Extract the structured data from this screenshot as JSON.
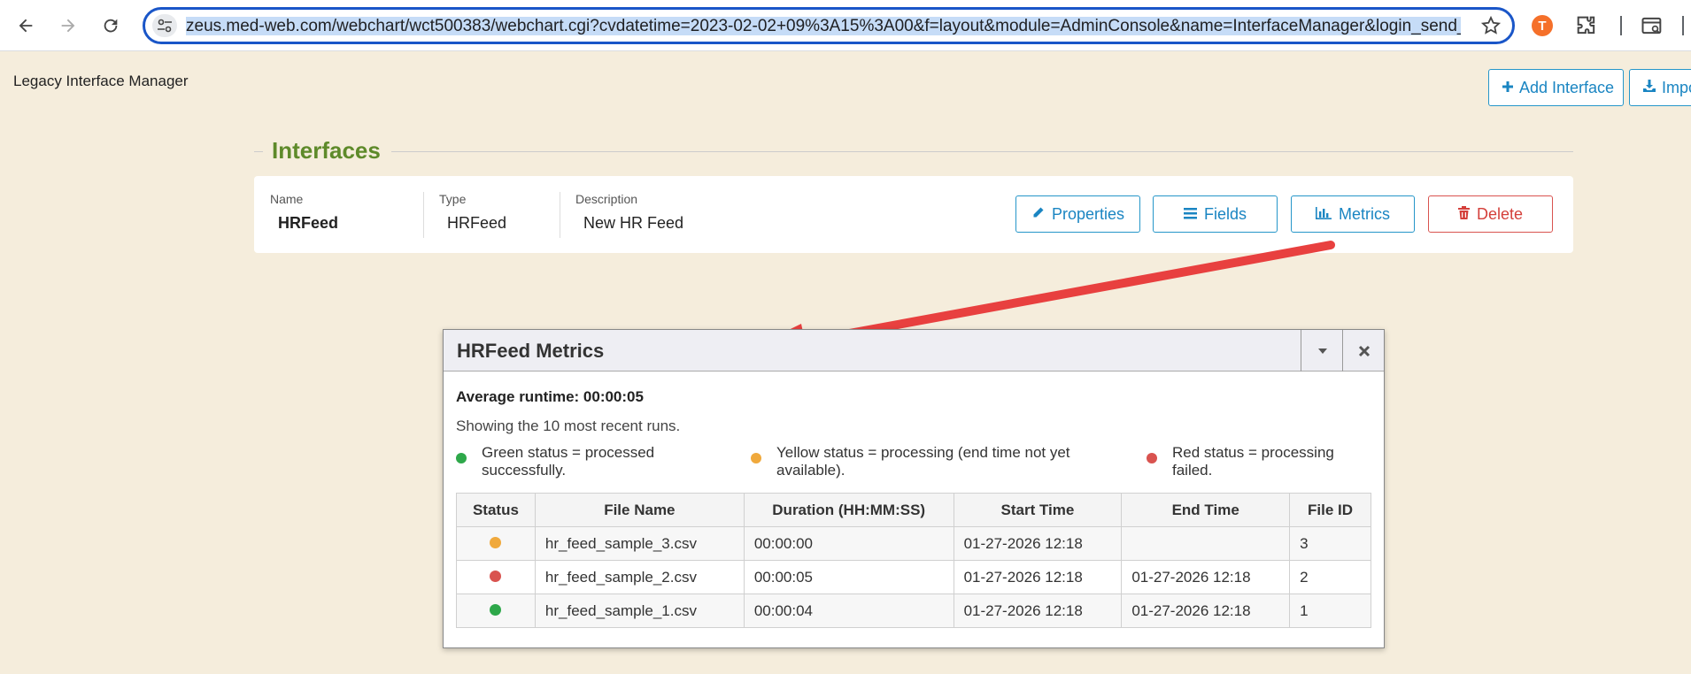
{
  "browser": {
    "url_highlighted": "zeus.med-web.com/webchart/wct500383/webchart.cgi?cvdatetime=2023-02-02+09%3A15%3A00&f=layout&module=AdminConsole&name=InterfaceManager&login_send_",
    "profile_initial": "T"
  },
  "page": {
    "app_title": "Legacy Interface Manager",
    "add_interface_label": "Add Interface",
    "import_label": "Impo"
  },
  "section": {
    "title": "Interfaces"
  },
  "interface": {
    "name_label": "Name",
    "name_value": "HRFeed",
    "type_label": "Type",
    "type_value": "HRFeed",
    "description_label": "Description",
    "description_value": "New HR Feed",
    "properties_label": "Properties",
    "fields_label": "Fields",
    "metrics_label": "Metrics",
    "delete_label": "Delete"
  },
  "dialog": {
    "title": "HRFeed Metrics",
    "average_runtime": "Average runtime: 00:00:05",
    "showing_text": "Showing the 10 most recent runs.",
    "legend": [
      {
        "color": "#2ea84a",
        "line1": "Green status = processed",
        "line2": "successfully."
      },
      {
        "color": "#f0a93c",
        "line1": "Yellow status = processing (end time not yet",
        "line2": "available)."
      },
      {
        "color": "#d9534f",
        "line1": "Red status = processing",
        "line2": "failed."
      }
    ],
    "columns": [
      "Status",
      "File Name",
      "Duration (HH:MM:SS)",
      "Start Time",
      "End Time",
      "File ID"
    ],
    "rows": [
      {
        "status_color": "#f0a93c",
        "file_name": "hr_feed_sample_3.csv",
        "duration": "00:00:00",
        "start": "01-27-2026 12:18",
        "end": "",
        "file_id": "3"
      },
      {
        "status_color": "#d9534f",
        "file_name": "hr_feed_sample_2.csv",
        "duration": "00:00:05",
        "start": "01-27-2026 12:18",
        "end": "01-27-2026 12:18",
        "file_id": "2"
      },
      {
        "status_color": "#2ea84a",
        "file_name": "hr_feed_sample_1.csv",
        "duration": "00:00:04",
        "start": "01-27-2026 12:18",
        "end": "01-27-2026 12:18",
        "file_id": "1"
      }
    ]
  }
}
